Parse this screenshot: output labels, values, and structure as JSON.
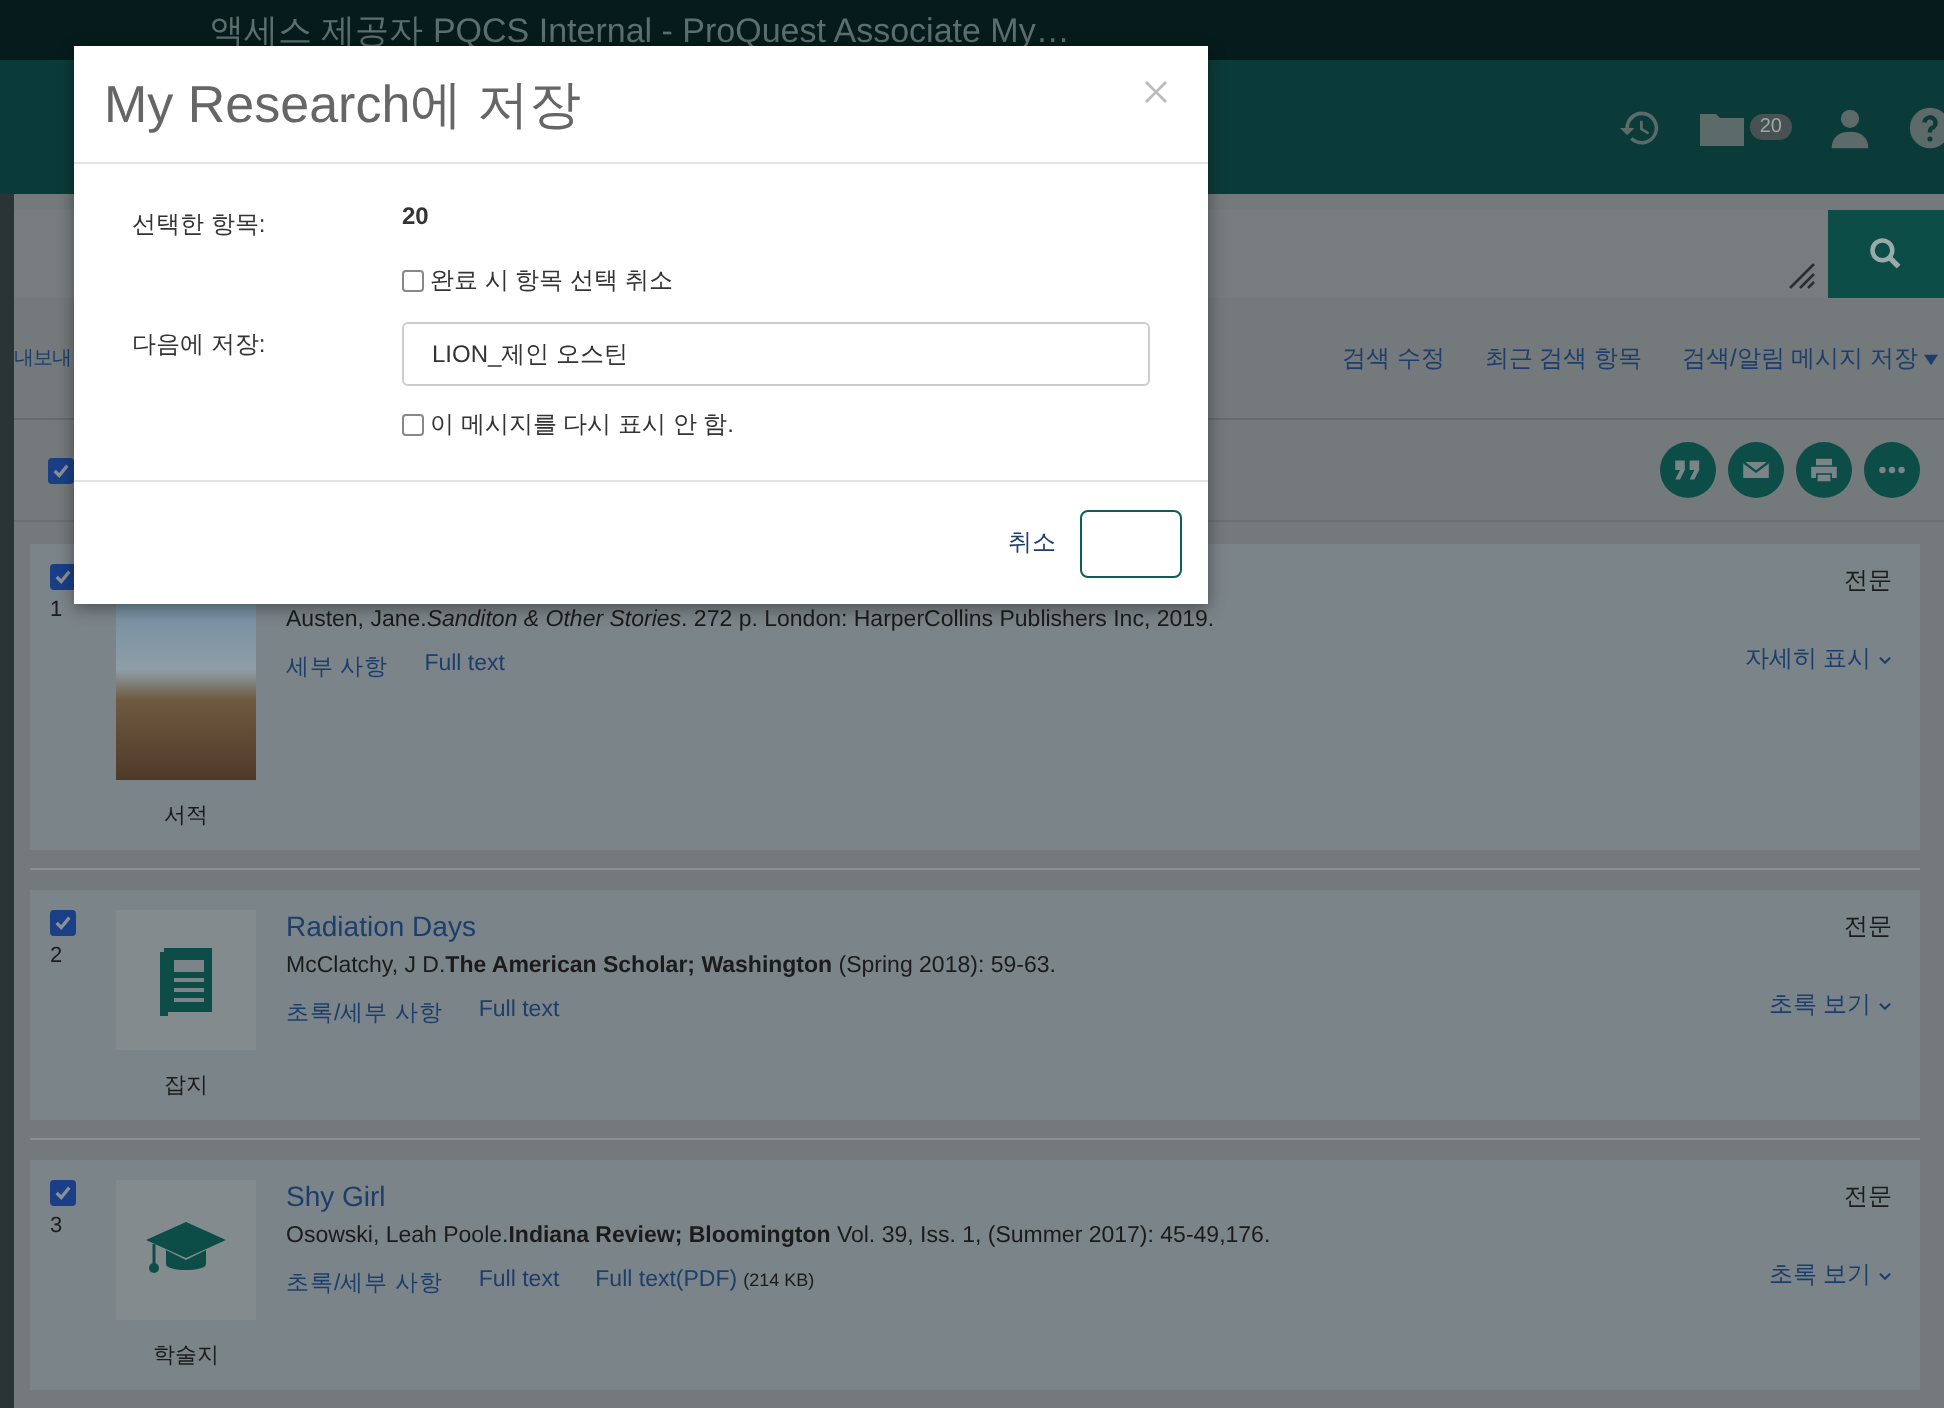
{
  "window": {
    "title": "액세스 제공자 PQCS Internal - ProQuest Associate My…"
  },
  "header": {
    "folder_count": "20"
  },
  "nav": {
    "partial_link": "내보내",
    "links": [
      "검색 수정",
      "최근 검색 항목"
    ],
    "dropdown": "검색/알림 메시지 저장"
  },
  "toolbar": {
    "select_all_checked": true
  },
  "results": [
    {
      "number": "1",
      "checked": true,
      "kind": "book",
      "type_label": "서적",
      "citation": "Austen, Jane.*Sanditon & Other Stories*. 272 p. London: HarperCollins Publishers Inc, 2019.",
      "links": [
        {
          "label": "세부 사항"
        },
        {
          "label": "Full text"
        }
      ],
      "access": "전문",
      "toggle": "자세히 표시"
    },
    {
      "number": "2",
      "checked": true,
      "kind": "magazine",
      "type_label": "잡지",
      "title": "Radiation Days",
      "citation": "McClatchy, J D.**The American Scholar; Washington** (Spring 2018): 59-63.",
      "links": [
        {
          "label": "초록/세부 사항"
        },
        {
          "label": "Full text"
        }
      ],
      "access": "전문",
      "toggle": "초록 보기"
    },
    {
      "number": "3",
      "checked": true,
      "kind": "scholarly",
      "type_label": "학술지",
      "title": "Shy Girl",
      "citation": "Osowski, Leah Poole.**Indiana Review; Bloomington** Vol. 39, Iss. 1,  (Summer 2017): 45-49,176.",
      "links": [
        {
          "label": "초록/세부 사항"
        },
        {
          "label": "Full text"
        },
        {
          "label": "Full text(PDF)",
          "note": "(214 KB)"
        }
      ],
      "access": "전문",
      "toggle": "초록 보기"
    }
  ],
  "modal": {
    "title": "My Research에 저장",
    "selected_label": "선택한 항목:",
    "selected_count": "20",
    "deselect_option": {
      "label": "완료 시 항목 선택 취소",
      "checked": false
    },
    "save_label": "다음에 저장:",
    "save_value": "LION_제인 오스틴",
    "dont_show_option": {
      "label": "이 메시지를 다시 표시 안 함.",
      "checked": false
    },
    "cancel": "취소"
  }
}
